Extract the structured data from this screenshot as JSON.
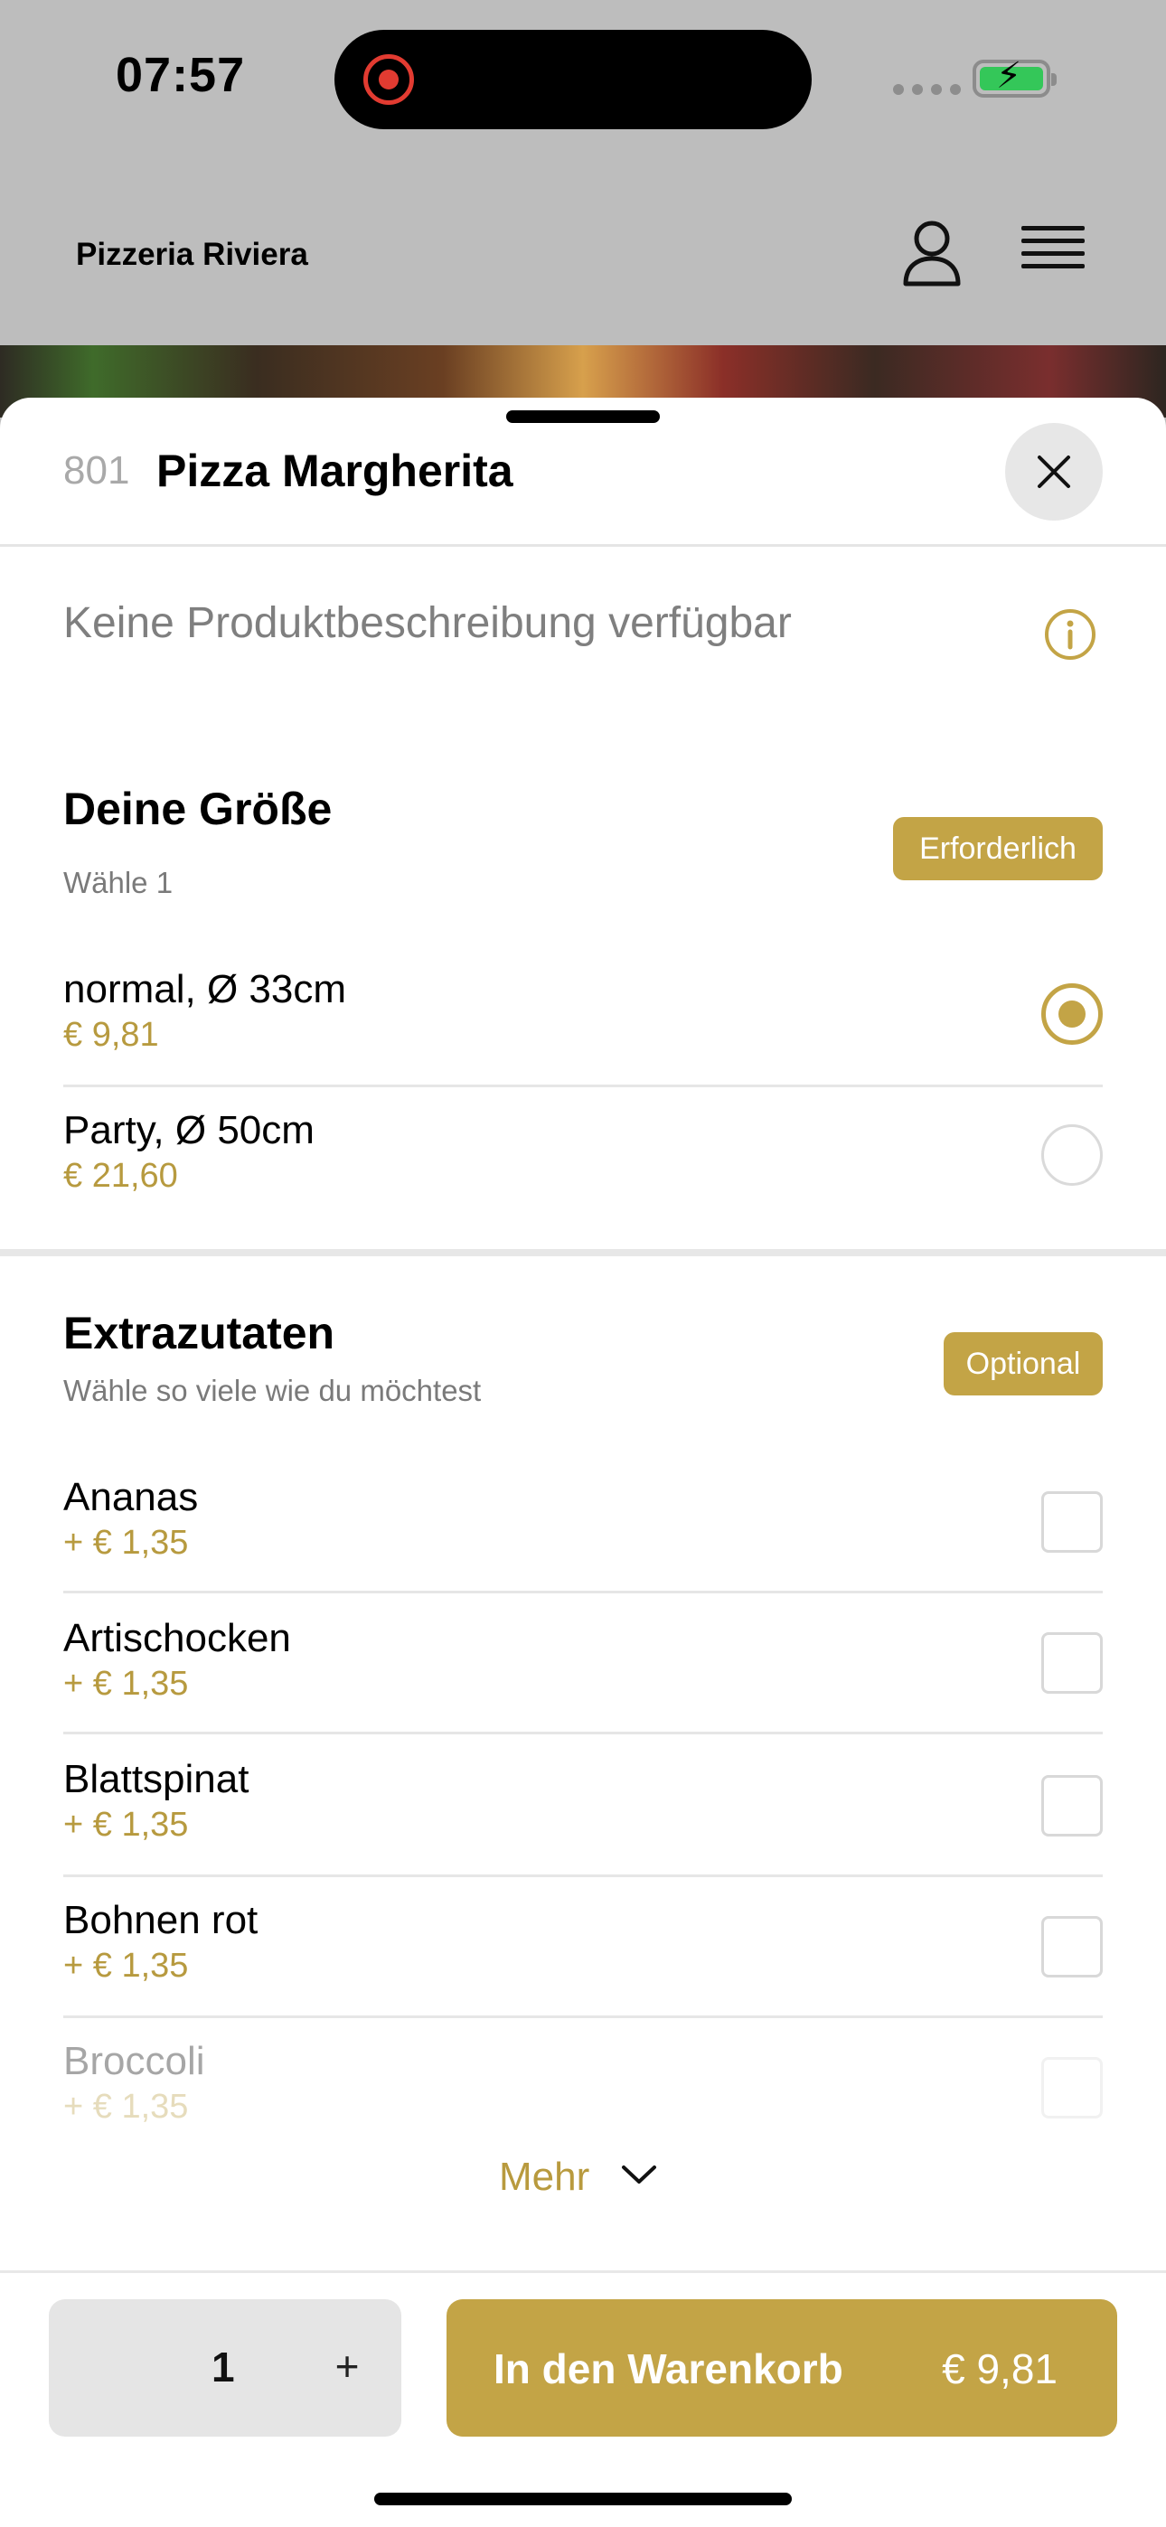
{
  "status_bar": {
    "time": "07:57"
  },
  "header": {
    "title": "Pizzeria Riviera"
  },
  "product": {
    "number": "801",
    "name": "Pizza Margherita",
    "description": "Keine Produktbeschreibung verfügbar"
  },
  "size_section": {
    "title": "Deine Größe",
    "subtitle": "Wähle 1",
    "badge": "Erforderlich",
    "options": [
      {
        "name": "normal, Ø 33cm",
        "price": "€ 9,81",
        "selected": true
      },
      {
        "name": "Party, Ø 50cm",
        "price": "€ 21,60",
        "selected": false
      }
    ]
  },
  "extras_section": {
    "title": "Extrazutaten",
    "subtitle": "Wähle so viele wie du möchtest",
    "badge": "Optional",
    "options": [
      {
        "name": "Ananas",
        "price": "+ € 1,35",
        "checked": false
      },
      {
        "name": "Artischocken",
        "price": "+ € 1,35",
        "checked": false
      },
      {
        "name": "Blattspinat",
        "price": "+ € 1,35",
        "checked": false
      },
      {
        "name": "Bohnen rot",
        "price": "+ € 1,35",
        "checked": false
      },
      {
        "name": "Broccoli",
        "price": "+ € 1,35",
        "checked": false
      }
    ],
    "more_label": "Mehr"
  },
  "footer": {
    "quantity": "1",
    "plus_label": "+",
    "cart_label": "In den Warenkorb",
    "cart_price": "€ 9,81"
  },
  "colors": {
    "accent": "#c3a446",
    "price": "#b79a3f",
    "record": "#e23b31",
    "battery": "#34c759"
  }
}
